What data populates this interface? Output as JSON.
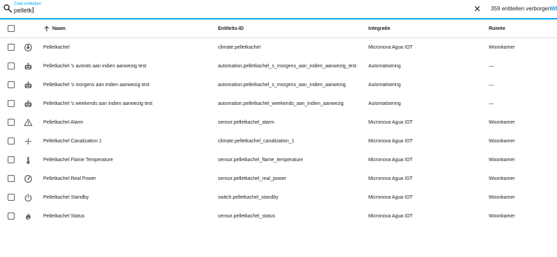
{
  "search": {
    "label": "Zoek entiteiten",
    "value": "pelletk"
  },
  "toolbar": {
    "hidden_count_text": "359 entiteiten verborgen",
    "show_link": "WE"
  },
  "table": {
    "headers": {
      "name": "Naam",
      "entity_id": "Entiteits-ID",
      "integration": "Integratie",
      "area": "Ruimte"
    },
    "rows": [
      {
        "icon": "thermostat-icon",
        "name": "Pelletkachel",
        "entity_id": "climate.pelletkachel",
        "integration": "Micronova Agua IOT",
        "area": "Woonkamer"
      },
      {
        "icon": "robot-icon",
        "name": "Pelletkachel 's avonds aan indien aanwezig test",
        "entity_id": "automation.pelletkachel_s_morgens_aan_indien_aanwezig_test",
        "integration": "Automatisering",
        "area": "—"
      },
      {
        "icon": "robot-icon",
        "name": "Pelletkachel 's morgens aan indien aanwezig test",
        "entity_id": "automation.pelletkachel_s_morgens_aan_indien_aanwezig",
        "integration": "Automatisering",
        "area": "—"
      },
      {
        "icon": "robot-icon",
        "name": "Pelletkachel 's weekends aan indien aanwezig test",
        "entity_id": "automation.pelletkachel_weekends_aan_indien_aanwezig",
        "integration": "Automatisering",
        "area": "—"
      },
      {
        "icon": "alert-icon",
        "name": "Pelletkachel Alarm",
        "entity_id": "sensor.pelletkachel_alarm",
        "integration": "Micronova Agua IOT",
        "area": "Woonkamer"
      },
      {
        "icon": "fan-icon",
        "name": "Pelletkachel Canalization 1",
        "entity_id": "climate.pelletkachel_canalization_1",
        "integration": "Micronova Agua IOT",
        "area": "Woonkamer"
      },
      {
        "icon": "thermometer-icon",
        "name": "Pelletkachel Flame Temperature",
        "entity_id": "sensor.pelletkachel_flame_temperature",
        "integration": "Micronova Agua IOT",
        "area": "Woonkamer"
      },
      {
        "icon": "gauge-icon",
        "name": "Pelletkachel Real Power",
        "entity_id": "sensor.pelletkachel_real_power",
        "integration": "Micronova Agua IOT",
        "area": "Woonkamer"
      },
      {
        "icon": "power-icon",
        "name": "Pelletkachel Standby",
        "entity_id": "switch.pelletkachel_standby",
        "integration": "Micronova Agua IOT",
        "area": "Woonkamer"
      },
      {
        "icon": "fire-icon",
        "name": "Pelletkachel Status",
        "entity_id": "sensor.pelletkachel_status",
        "integration": "Micronova Agua IOT",
        "area": "Woonkamer"
      }
    ]
  },
  "colors": {
    "accent": "#03a9f4",
    "text": "#212121",
    "icon": "#5f5f5f",
    "divider": "#e0e0e0"
  }
}
